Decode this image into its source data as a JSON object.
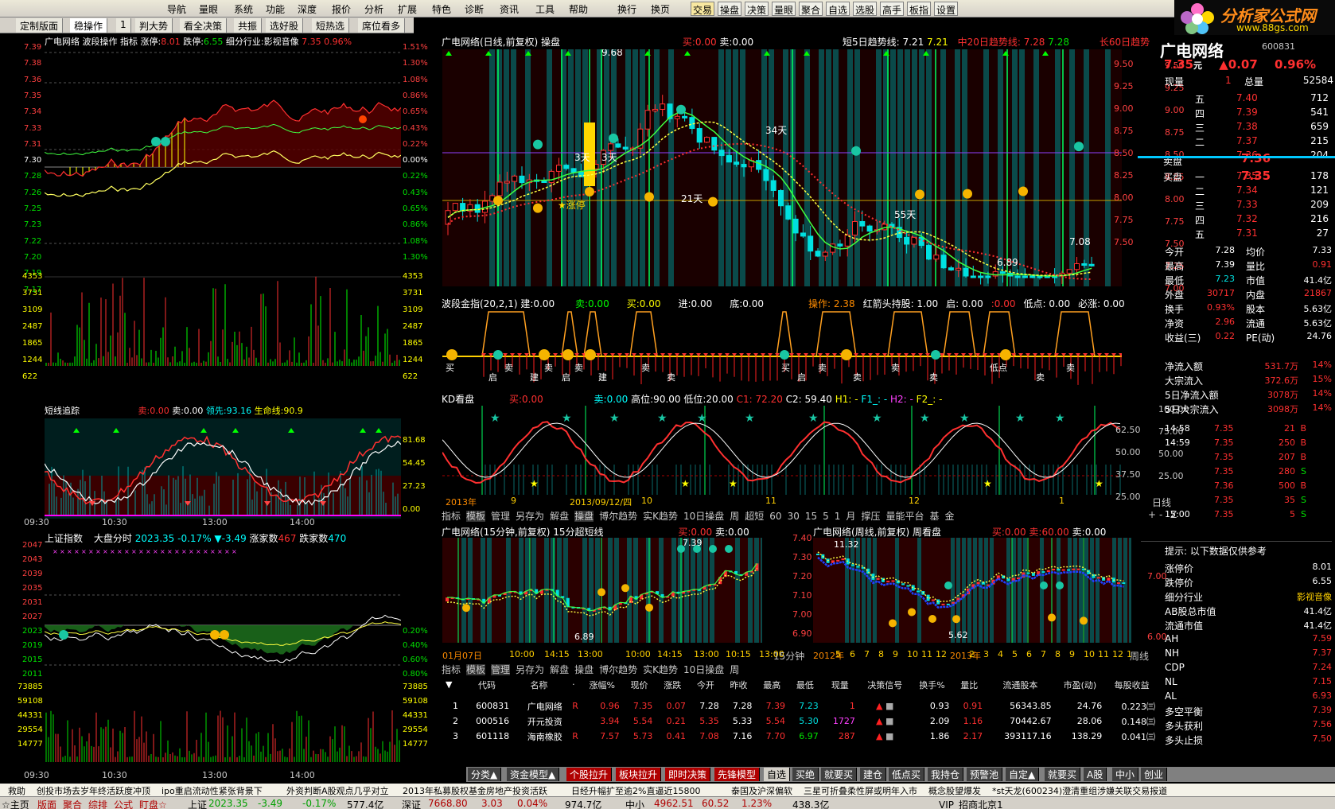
{
  "menu": {
    "items": [
      "导航",
      "量眼",
      "系统",
      "功能",
      "深度",
      "报价",
      "分析",
      "扩展",
      "特色",
      "诊断",
      "资讯",
      "工具",
      "帮助",
      "换行",
      "换页"
    ],
    "tools": [
      "交易",
      "操盘",
      "决策",
      "量眼",
      "聚合",
      "自选",
      "选股",
      "高手",
      "板指",
      "设置"
    ]
  },
  "logo": {
    "text": "分析家公式网",
    "url": "www.88gs.com"
  },
  "tabs": [
    "定制版面",
    "稳操作",
    "1",
    "判大势",
    "看全决策",
    "共振",
    "选好股",
    "短热选",
    "席位看多"
  ],
  "intraday": {
    "header": "广电网络  波段操作 指标 涨停:",
    "limit_up": "8.01",
    "limit_down_label": "跌停:",
    "limit_down": "6.55",
    "industry_label": "细分行业:影视音像",
    "price": "7.35",
    "pct": "0.96%",
    "left_axis": [
      "7.39",
      "7.38",
      "7.36",
      "7.35",
      "7.34",
      "7.33",
      "7.31",
      "7.30",
      "7.28",
      "7.26",
      "7.25",
      "7.23",
      "7.22",
      "7.20",
      "7.19",
      "7.17"
    ],
    "right_axis": [
      "1.51%",
      "1.30%",
      "1.08%",
      "0.86%",
      "0.65%",
      "0.43%",
      "0.22%",
      "0.00%",
      "0.22%",
      "0.43%",
      "0.65%",
      "0.86%",
      "1.08%",
      "1.30%"
    ],
    "vol_axis": [
      "4353",
      "3731",
      "3109",
      "2487",
      "1865",
      "1244",
      "622"
    ],
    "track_header": "短线追踪",
    "track_buy": "卖:0.00",
    "track_sell": "卖:0.00",
    "track_lead": "领先:93.16",
    "track_life": "生命线:90.9",
    "track_axis": [
      "81.68",
      "54.45",
      "27.23",
      "0.00"
    ],
    "time_axis": [
      "09:30",
      "10:30",
      "13:00",
      "14:00"
    ]
  },
  "index": {
    "name": "上证指数",
    "label": "大盘分时",
    "value": "2023.35",
    "chg_pct": "-0.17%",
    "chg": "▼-3.49",
    "up_label": "涨家数",
    "up": "467",
    "down_label": "跌家数",
    "down": "470",
    "left_axis": [
      "2047",
      "2043",
      "2039",
      "2035",
      "2031",
      "2027",
      "2023",
      "2019",
      "2015",
      "2011"
    ],
    "right_axis": [
      "0.20%",
      "0.40%",
      "0.60%",
      "0.80%"
    ],
    "vol_axis": [
      "73885",
      "59108",
      "44331",
      "29554",
      "14777"
    ],
    "time_axis": [
      "09:30",
      "10:30",
      "13:00",
      "14:00"
    ]
  },
  "kline": {
    "header": "广电网络(日线,前复权) 操盘",
    "buy": "买:0.00",
    "sell": "卖:0.00",
    "short5": "短5日趋势线: 7.21",
    "short5b": "7.21",
    "mid20": "中20日趋势线: 7.28",
    "mid20b": "7.28",
    "long60": "长60日趋势",
    "right_axis": [
      "9.50",
      "9.25",
      "9.00",
      "8.75",
      "8.50",
      "8.25",
      "8.00",
      "7.75",
      "7.50",
      "7.25",
      "7.00"
    ],
    "annotations": [
      "9.68",
      "3天",
      "3天",
      "★涨停",
      "21天",
      "34天",
      "55天",
      "6.89",
      "7.08"
    ],
    "wave_header": "波段金指(20,2,1) 建:0.00",
    "wave_items": [
      "卖:0.00",
      "买:0.00",
      "进:0.00",
      "底:0.00"
    ],
    "wave_right": [
      "操作: 2.38",
      "红箭头持股: 1.00",
      "启: 0.00",
      ":0.00",
      "低点: 0.00",
      "必涨: 0.00"
    ],
    "wave_labels": [
      "买",
      "启",
      "卖",
      "建",
      "卖",
      "启",
      "卖",
      "建",
      "卖",
      "卖",
      "买",
      "启",
      "卖",
      "卖",
      "卖",
      "卖",
      "低点",
      "卖",
      "卖"
    ],
    "kd_header": "KD看盘",
    "kd_buy": "买:0.00",
    "kd_sell": "卖:0.00",
    "kd_high": "高位:90.00",
    "kd_low": "低位:20.00",
    "kd_c1": "C1: 72.20",
    "kd_c2": "C2: 59.40",
    "kd_h1": "H1: -",
    "kd_f1": "F1_: -",
    "kd_h2": "H2: -",
    "kd_f2": "F2_: -",
    "kd_axis": [
      "100.00",
      "75.00",
      "50.00",
      "25.00"
    ],
    "date_axis": [
      "2013年",
      "9",
      "2013/09/12/四",
      "10",
      "11",
      "12",
      "1"
    ],
    "date_right": "日线",
    "toolbar": [
      "指标",
      "模板",
      "管理",
      "另存为",
      "解盘",
      "操盘",
      "博尔趋势",
      "实K趋势",
      "10日操盘",
      "周",
      "超短",
      "60",
      "30",
      "15",
      "5",
      "1",
      "月",
      "撑压",
      "量能平台",
      "基",
      "金"
    ],
    "tool_right": [
      "+",
      "-",
      "Z"
    ]
  },
  "min15": {
    "header": "广电网络(15分钟,前复权) 15分超短线",
    "buy": "买:0.00",
    "sell": "卖:0.00",
    "annotations": [
      "7.39",
      "6.89"
    ],
    "date_axis": [
      "01月07日",
      "10:00",
      "14:15",
      "13:00",
      "10:00",
      "14:15",
      "13:00",
      "10:15",
      "13:00"
    ],
    "unit": "15分钟"
  },
  "weekly": {
    "header": "广电网络(周线,前复权) 周看盘",
    "buy": "买:0.00",
    "sell": "卖:60.00",
    "sell2": "卖:0.00",
    "left_axis": [
      "7.40",
      "7.30",
      "7.20",
      "7.10",
      "7.00",
      "6.90"
    ],
    "right_axis": [
      "7.00",
      "6.00"
    ],
    "annotations": [
      "11.32",
      "5.62"
    ],
    "date_axis": [
      "2012年",
      "5",
      "6",
      "7",
      "8",
      "9",
      "10",
      "11",
      "12",
      "2013年",
      "2",
      "3",
      "4",
      "5",
      "6",
      "7",
      "8",
      "9",
      "10",
      "11",
      "12",
      "1"
    ],
    "unit": "周线"
  },
  "tb2": [
    "指标",
    "模板",
    "管理",
    "另存为",
    "解盘",
    "操盘",
    "博尔趋势",
    "实K趋势",
    "10日操盘",
    "周"
  ],
  "table": {
    "headers": [
      "代码",
      "名称",
      "·",
      "涨幅%",
      "现价",
      "涨跌",
      "今开",
      "昨收",
      "最高",
      "最低",
      "现量",
      "决策信号",
      "换手%",
      "量比",
      "流通股本",
      "市盈(动)",
      "每股收益"
    ],
    "rows": [
      {
        "no": "1",
        "code": "600831",
        "name": "广电网络",
        "r": "R",
        "pct": "0.96",
        "price": "7.35",
        "chg": "0.07",
        "open": "7.28",
        "prev": "7.28",
        "high": "7.39",
        "low": "7.23",
        "vol": "1",
        "turn": "0.93",
        "ratio": "0.91",
        "float": "56343.85",
        "pe": "24.76",
        "eps": "0.223㈢"
      },
      {
        "no": "2",
        "code": "000516",
        "name": "开元投资",
        "r": "",
        "pct": "3.94",
        "price": "5.54",
        "chg": "0.21",
        "open": "5.35",
        "prev": "5.33",
        "high": "5.54",
        "low": "5.30",
        "vol": "1727",
        "turn": "2.09",
        "ratio": "1.16",
        "float": "70442.67",
        "pe": "28.06",
        "eps": "0.148㈢"
      },
      {
        "no": "3",
        "code": "601118",
        "name": "海南橡胶",
        "r": "R",
        "pct": "7.57",
        "price": "5.73",
        "chg": "0.41",
        "open": "7.08",
        "prev": "7.16",
        "high": "7.70",
        "low": "6.97",
        "vol": "287",
        "turn": "1.86",
        "ratio": "2.17",
        "float": "393117.16",
        "pe": "138.29",
        "eps": "0.041㈢"
      }
    ]
  },
  "bottom_tabs": [
    "分类▲",
    "资金模型▲",
    "个股拉升",
    "板块拉升",
    "即时决策",
    "先锋模型",
    "自选",
    "买绝",
    "就要买",
    "建仓",
    "低点买",
    "我持仓",
    "预警池",
    "自定▲",
    "就要买",
    "A股",
    "中小",
    "创业"
  ],
  "quote": {
    "name": "广电网络",
    "code": "600831",
    "price": "7.35",
    "price_unit": "元",
    "chg": "▲0.07",
    "pct": "0.96%",
    "now_label": "现量",
    "now": "1",
    "total_label": "总量",
    "total": "52584",
    "asks": [
      {
        "l": "五",
        "p": "7.40",
        "v": "712"
      },
      {
        "l": "四",
        "p": "7.39",
        "v": "541"
      },
      {
        "l": "三",
        "p": "7.38",
        "v": "659"
      },
      {
        "l": "二",
        "p": "7.37",
        "v": "215"
      },
      {
        "l": "一",
        "p": "7.36",
        "v": "204"
      }
    ],
    "ask_label": "卖盘",
    "ask_price": "7.36",
    "bid_label": "买盘",
    "bid_price": "7.35",
    "bids": [
      {
        "l": "一",
        "p": "7.35",
        "v": "178"
      },
      {
        "l": "二",
        "p": "7.34",
        "v": "121"
      },
      {
        "l": "三",
        "p": "7.33",
        "v": "209"
      },
      {
        "l": "四",
        "p": "7.32",
        "v": "216"
      },
      {
        "l": "五",
        "p": "7.31",
        "v": "27"
      }
    ],
    "left_axis": [
      "9.50",
      "9.25",
      "9.00",
      "8.75",
      "8.50",
      "8.25",
      "8.00",
      "7.75",
      "7.50"
    ],
    "stats": [
      [
        "今开",
        "7.28",
        "均价",
        "7.33"
      ],
      [
        "最高",
        "7.39",
        "量比",
        "0.91"
      ],
      [
        "最低",
        "7.23",
        "市值",
        "41.4亿"
      ],
      [
        "外盘",
        "30717",
        "内盘",
        "21867"
      ],
      [
        "换手",
        "0.93%",
        "股本",
        "5.63亿"
      ],
      [
        "净资",
        "2.96",
        "流通",
        "5.63亿"
      ],
      [
        "收益(三)",
        "0.22",
        "PE(动)",
        "24.76"
      ]
    ],
    "flows": [
      [
        "净流入额",
        "531.7万",
        "14%"
      ],
      [
        "大宗流入",
        "372.6万",
        "15%"
      ],
      [
        "5日净流入额",
        "3078万",
        "14%"
      ],
      [
        "5日大宗流入",
        "3098万",
        "14%"
      ]
    ],
    "ticks": [
      [
        "14:58",
        "7.35",
        "21",
        "B"
      ],
      [
        "14:59",
        "7.35",
        "250",
        "B"
      ],
      [
        "",
        "7.35",
        "207",
        "B"
      ],
      [
        "",
        "7.35",
        "280",
        "S"
      ],
      [
        "",
        "7.36",
        "500",
        "B"
      ],
      [
        "",
        "7.35",
        "35",
        "S"
      ],
      [
        "15:00",
        "7.35",
        "5",
        "S"
      ]
    ],
    "tick_axis": [
      "62.50",
      "50.00",
      "37.50",
      "25.00"
    ],
    "tip": "提示: 以下数据仅供参考",
    "info": [
      [
        "涨停价",
        "8.01"
      ],
      [
        "跌停价",
        "6.55"
      ],
      [
        "细分行业",
        "影视音像"
      ],
      [
        "AB股总市值",
        "41.4亿"
      ],
      [
        "流通市值",
        "41.4亿"
      ],
      [
        "AH",
        "7.59"
      ],
      [
        "NH",
        "7.37"
      ],
      [
        "CDP",
        "7.24"
      ],
      [
        "NL",
        "7.15"
      ],
      [
        "AL",
        "6.93"
      ],
      [
        "多空平衡",
        "7.39"
      ],
      [
        "多头获利",
        "7.56"
      ],
      [
        "多头止损",
        "7.50"
      ]
    ]
  },
  "ticker": [
    "救助",
    "创投市场去岁年终活跃度冲顶",
    "ipo重启流动性紧张背景下",
    "外资判断A股观点几乎对立",
    "2013年私募股权基金房地产投资活跃",
    "日经升幅扩至逾2%直逼近15800",
    "泰国及沪深偏软",
    "三星可折叠柔性屏或明年入市",
    "概念股望爆发",
    "*st天龙(600234)澄清重组涉嫌关联交易报道"
  ],
  "status": {
    "items": [
      "☆主页",
      "版面",
      "聚合",
      "综排",
      "公式",
      "盯盘☆"
    ],
    "sh_label": "上证",
    "sh": "2023.35",
    "sh_chg": "-3.49",
    "sh_pct": "-0.17%",
    "sh_amt": "577.4亿",
    "sz_label": "深证",
    "sz": "7668.80",
    "sz_chg": "3.03",
    "sz_pct": "0.04%",
    "sz_amt": "974.7亿",
    "zx_label": "中小",
    "zx": "4962.51",
    "zx_chg": "60.52",
    "zx_pct": "1.23%",
    "zx_amt": "438.3亿",
    "vip": "VIP_招商北京1"
  }
}
